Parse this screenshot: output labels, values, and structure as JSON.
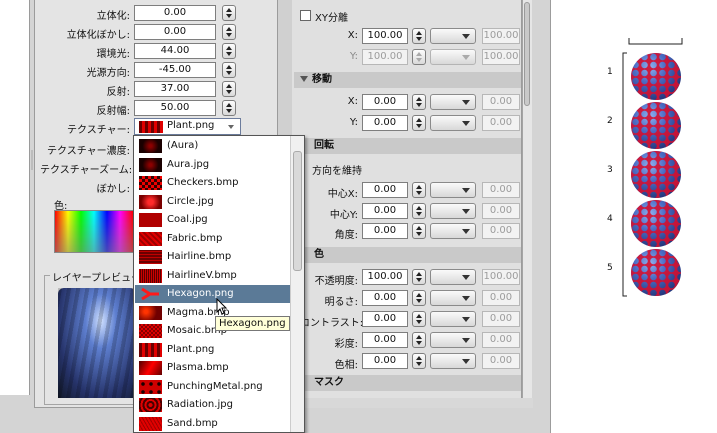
{
  "left_panel": {
    "rows": [
      {
        "label": "立体化:",
        "value": "0.00"
      },
      {
        "label": "立体化ぼかし:",
        "value": "0.00"
      },
      {
        "label": "環境光:",
        "value": "44.00"
      },
      {
        "label": "光源方向:",
        "value": "-45.00"
      },
      {
        "label": "反射:",
        "value": "37.00"
      },
      {
        "label": "反射幅:",
        "value": "50.00"
      }
    ],
    "texture_label": "テクスチャー:",
    "texture_value": "Plant.png",
    "texture_density_label": "テクスチャー濃度:",
    "texture_zoom_label": "テクスチャーズーム:",
    "blur_label": "ぼかし:",
    "color_label": "色:",
    "layer_preview_label": "レイヤープレビュー"
  },
  "texture_list": {
    "items": [
      {
        "name": "(Aura)",
        "tex": "tex-aura"
      },
      {
        "name": "Aura.jpg",
        "tex": "tex-aura"
      },
      {
        "name": "Checkers.bmp",
        "tex": "tex-checker"
      },
      {
        "name": "Circle.jpg",
        "tex": "tex-circle"
      },
      {
        "name": "Coal.jpg",
        "tex": "tex-coal"
      },
      {
        "name": "Fabric.bmp",
        "tex": "tex-fabric"
      },
      {
        "name": "Hairline.bmp",
        "tex": "tex-hairline"
      },
      {
        "name": "HairlineV.bmp",
        "tex": "tex-hairlinev"
      },
      {
        "name": "Hexagon.png",
        "tex": "tex-hex"
      },
      {
        "name": "Magma.bmp",
        "tex": "tex-magma"
      },
      {
        "name": "Mosaic.bmp",
        "tex": "tex-mosaic"
      },
      {
        "name": "Plant.png",
        "tex": "tex-plant"
      },
      {
        "name": "Plasma.bmp",
        "tex": "tex-plasma"
      },
      {
        "name": "PunchingMetal.png",
        "tex": "tex-punch"
      },
      {
        "name": "Radiation.jpg",
        "tex": "tex-radiation"
      },
      {
        "name": "Sand.bmp",
        "tex": "tex-sand"
      }
    ],
    "selected": "Hexagon.png",
    "tooltip": "Hexagon.png"
  },
  "mid_panel": {
    "xy_split_label": "XY分離",
    "scale_x_label": "X:",
    "scale_x_value": "100.00",
    "scale_x_right": "100.00",
    "scale_y_label": "Y:",
    "scale_y_value": "100.00",
    "scale_y_right": "100.00",
    "move_header": "移動",
    "move_x_label": "X:",
    "move_x_value": "0.00",
    "move_x_right": "0.00",
    "move_y_label": "Y:",
    "move_y_value": "0.00",
    "move_y_right": "0.00",
    "rotate_header": "回転",
    "keep_direction": "方向を維持",
    "center_x_label": "中心X:",
    "center_x_value": "0.00",
    "center_x_right": "0.00",
    "center_y_label": "中心Y:",
    "center_y_value": "0.00",
    "center_y_right": "0.00",
    "angle_label": "角度:",
    "angle_value": "0.00",
    "angle_right": "0.00",
    "color_header": "色",
    "opacity_label": "不透明度:",
    "opacity_value": "100.00",
    "opacity_right": "100.00",
    "brightness_label": "明るさ:",
    "brightness_value": "0.00",
    "brightness_right": "0.00",
    "contrast_label": "コントラスト:",
    "contrast_value": "0.00",
    "contrast_right": "0.00",
    "saturation_label": "彩度:",
    "saturation_value": "0.00",
    "saturation_right": "0.00",
    "hue_label": "色相:",
    "hue_value": "0.00",
    "hue_right": "0.00",
    "mask_header": "マスク"
  },
  "canvas": {
    "labels": [
      "1",
      "2",
      "3",
      "4",
      "5"
    ]
  }
}
